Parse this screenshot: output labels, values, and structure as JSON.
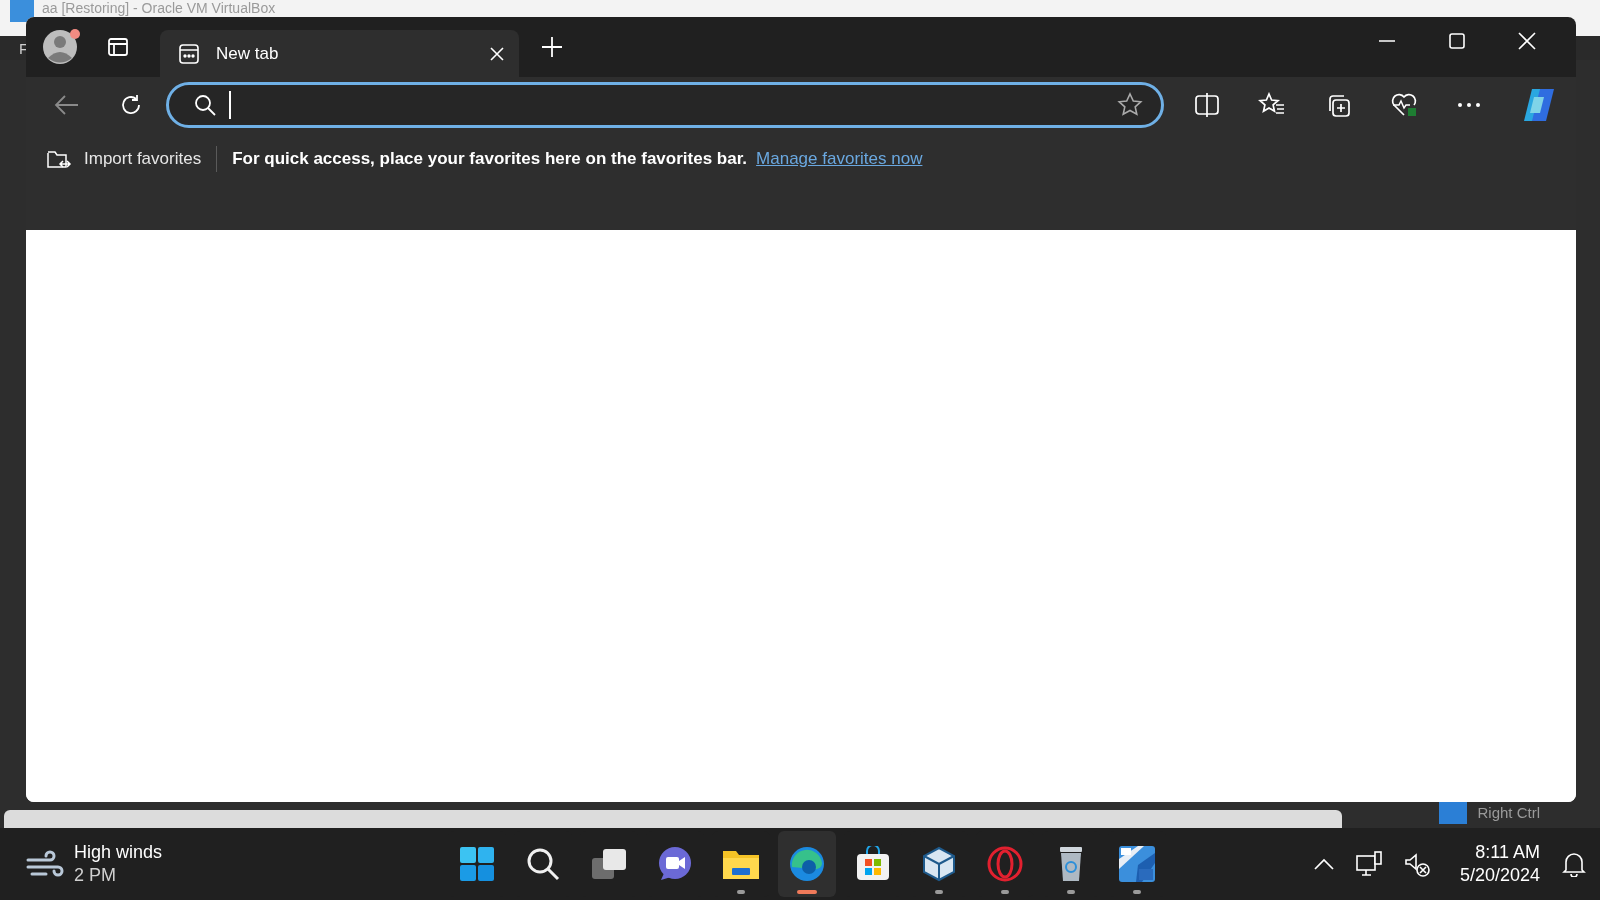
{
  "vbox_window": {
    "title": "aa [Restoring] - Oracle VM VirtualBox",
    "menu_item": "F",
    "status_text": "Right Ctrl"
  },
  "browser": {
    "tabs": [
      {
        "title": "New tab",
        "selected": true
      }
    ],
    "address_bar": {
      "focused": true
    },
    "profile_notification": true
  },
  "favorites_bar": {
    "import_label": "Import favorites",
    "message": "For quick access, place your favorites here on the favorites bar.",
    "link": "Manage favorites now"
  },
  "taskbar": {
    "weather": {
      "condition": "High winds",
      "time": "2 PM"
    },
    "apps": [
      {
        "kind": "start",
        "running": false,
        "selected": false
      },
      {
        "kind": "search",
        "running": false,
        "selected": false
      },
      {
        "kind": "taskview",
        "running": false,
        "selected": false
      },
      {
        "kind": "chat",
        "running": false,
        "selected": false
      },
      {
        "kind": "files",
        "running": true,
        "selected": false
      },
      {
        "kind": "edge",
        "running": true,
        "selected": true
      },
      {
        "kind": "store",
        "running": false,
        "selected": false
      },
      {
        "kind": "vbox",
        "running": true,
        "selected": false
      },
      {
        "kind": "opera",
        "running": true,
        "selected": false
      },
      {
        "kind": "bin",
        "running": true,
        "selected": false
      },
      {
        "kind": "win10",
        "running": true,
        "selected": false
      }
    ],
    "clock": {
      "time": "8:11 AM",
      "date": "5/20/2024"
    }
  }
}
